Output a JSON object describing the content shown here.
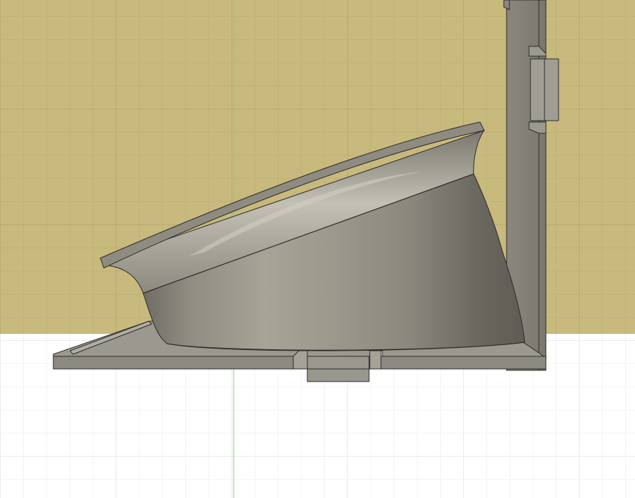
{
  "viewport": {
    "view": "orthographic-side-view",
    "colors": {
      "upper_background": "#c8b97d",
      "lower_background": "#ffffff",
      "grid_minor_upper": "#b9ab72",
      "grid_major_upper": "#a99b63",
      "grid_minor_lower": "#e9e9e9",
      "grid_major_lower": "#d6d6d6",
      "vertical_axis": "#7fcf6a",
      "model_body": "#8f8c82",
      "model_dark": "#6f6c64",
      "model_light": "#b8b5aa",
      "bracket_face": "#98958c",
      "bracket_side": "#7d7a72",
      "edge_line": "#2b2a27"
    }
  },
  "model": {
    "components": [
      "bowl-body",
      "l-bracket-base",
      "l-bracket-upright",
      "base-tab",
      "upright-tab"
    ]
  }
}
